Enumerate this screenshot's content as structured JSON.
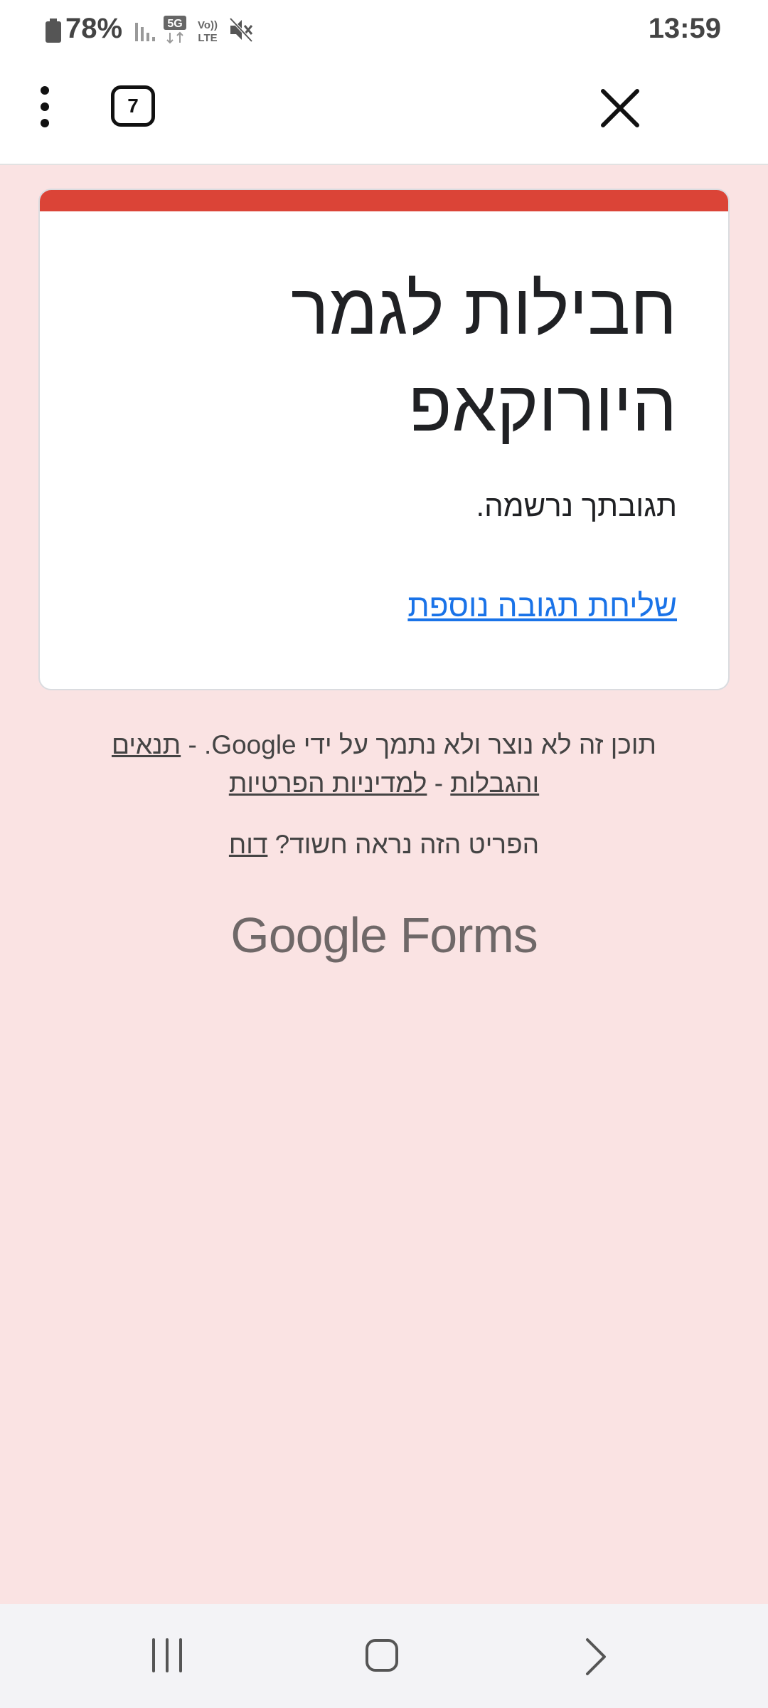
{
  "status_bar": {
    "battery_text": "78%",
    "network_label": "5G",
    "volte_label_top": "Vo))",
    "volte_label_bottom": "LTE",
    "time": "13:59",
    "icons": [
      "battery-icon",
      "signal-icon",
      "network-5g-icon",
      "volte-icon",
      "mute-icon"
    ]
  },
  "toolbar": {
    "tab_count": "7",
    "icons": [
      "more-vert-icon",
      "tab-switcher-icon",
      "close-icon"
    ]
  },
  "form": {
    "title": "חבילות לגמר היורוקאפ",
    "confirmation": "תגובתך נרשמה.",
    "submit_another": "שליחת תגובה נוספת",
    "accent_color": "#db4437",
    "link_color": "#1a73e8"
  },
  "footer": {
    "disclaimer": "תוכן זה לא נוצר ולא נתמך על ידי Google. -",
    "terms_link": "תנאים והגבלות",
    "separator": "-",
    "privacy_link": "למדיניות הפרטיות",
    "report_question": "הפריט הזה נראה חשוד?",
    "report_link": "דוח",
    "logo_google": "Google",
    "logo_forms": "Forms"
  },
  "nav_bar": {
    "icons": [
      "recent-apps-icon",
      "home-icon",
      "back-icon"
    ]
  },
  "background_color": "#fae3e3"
}
